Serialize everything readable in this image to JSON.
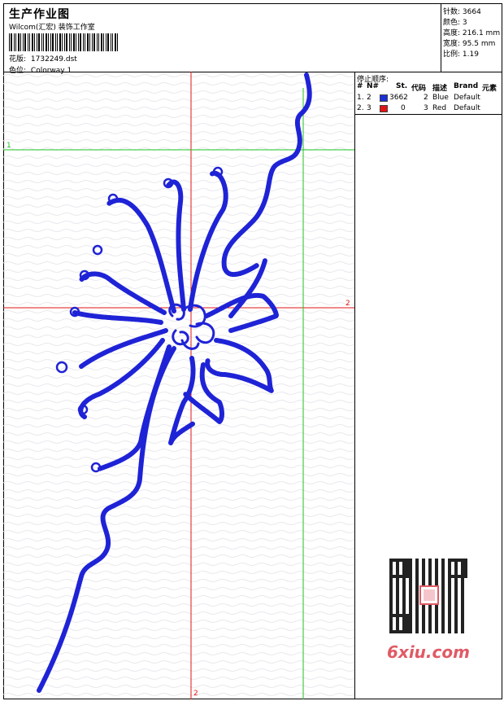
{
  "header": {
    "title": "生产作业图",
    "company": "Wilcom(汇宏) 装饰工作室",
    "design_label": "花版:",
    "design_file": "1732249.dst",
    "colorway_label": "色位:",
    "colorway_value": "Colorway 1"
  },
  "stats": [
    {
      "label": "针数:",
      "value": "3664"
    },
    {
      "label": "颜色:",
      "value": "3"
    },
    {
      "label": "高度:",
      "value": "216.1 mm"
    },
    {
      "label": "宽度:",
      "value": "95.5 mm"
    },
    {
      "label": "比例:",
      "value": "1.19"
    }
  ],
  "stop_sequence": {
    "title": "停止顺序:",
    "columns": [
      "#",
      "N#",
      "St.",
      "代码",
      "描述",
      "Brand",
      "元素"
    ],
    "rows": [
      {
        "idx": "1.",
        "n": "2",
        "color": "#1a2fd8",
        "stitches": "3662",
        "code": "2",
        "desc": "Blue",
        "brand": "Default"
      },
      {
        "idx": "2.",
        "n": "3",
        "color": "#e01414",
        "stitches": "0",
        "code": "3",
        "desc": "Red",
        "brand": "Default"
      }
    ]
  },
  "guides": {
    "green_h_label": "1",
    "red_h_label": "2",
    "red_v_label": "2"
  },
  "colors": {
    "thread": "#1f23d6",
    "red_guide": "#e01414",
    "green_guide": "#21c321",
    "watermark": "#e05a66"
  },
  "watermark": {
    "site": "6xiu.com",
    "qr_icon": "qr-code-icon"
  }
}
